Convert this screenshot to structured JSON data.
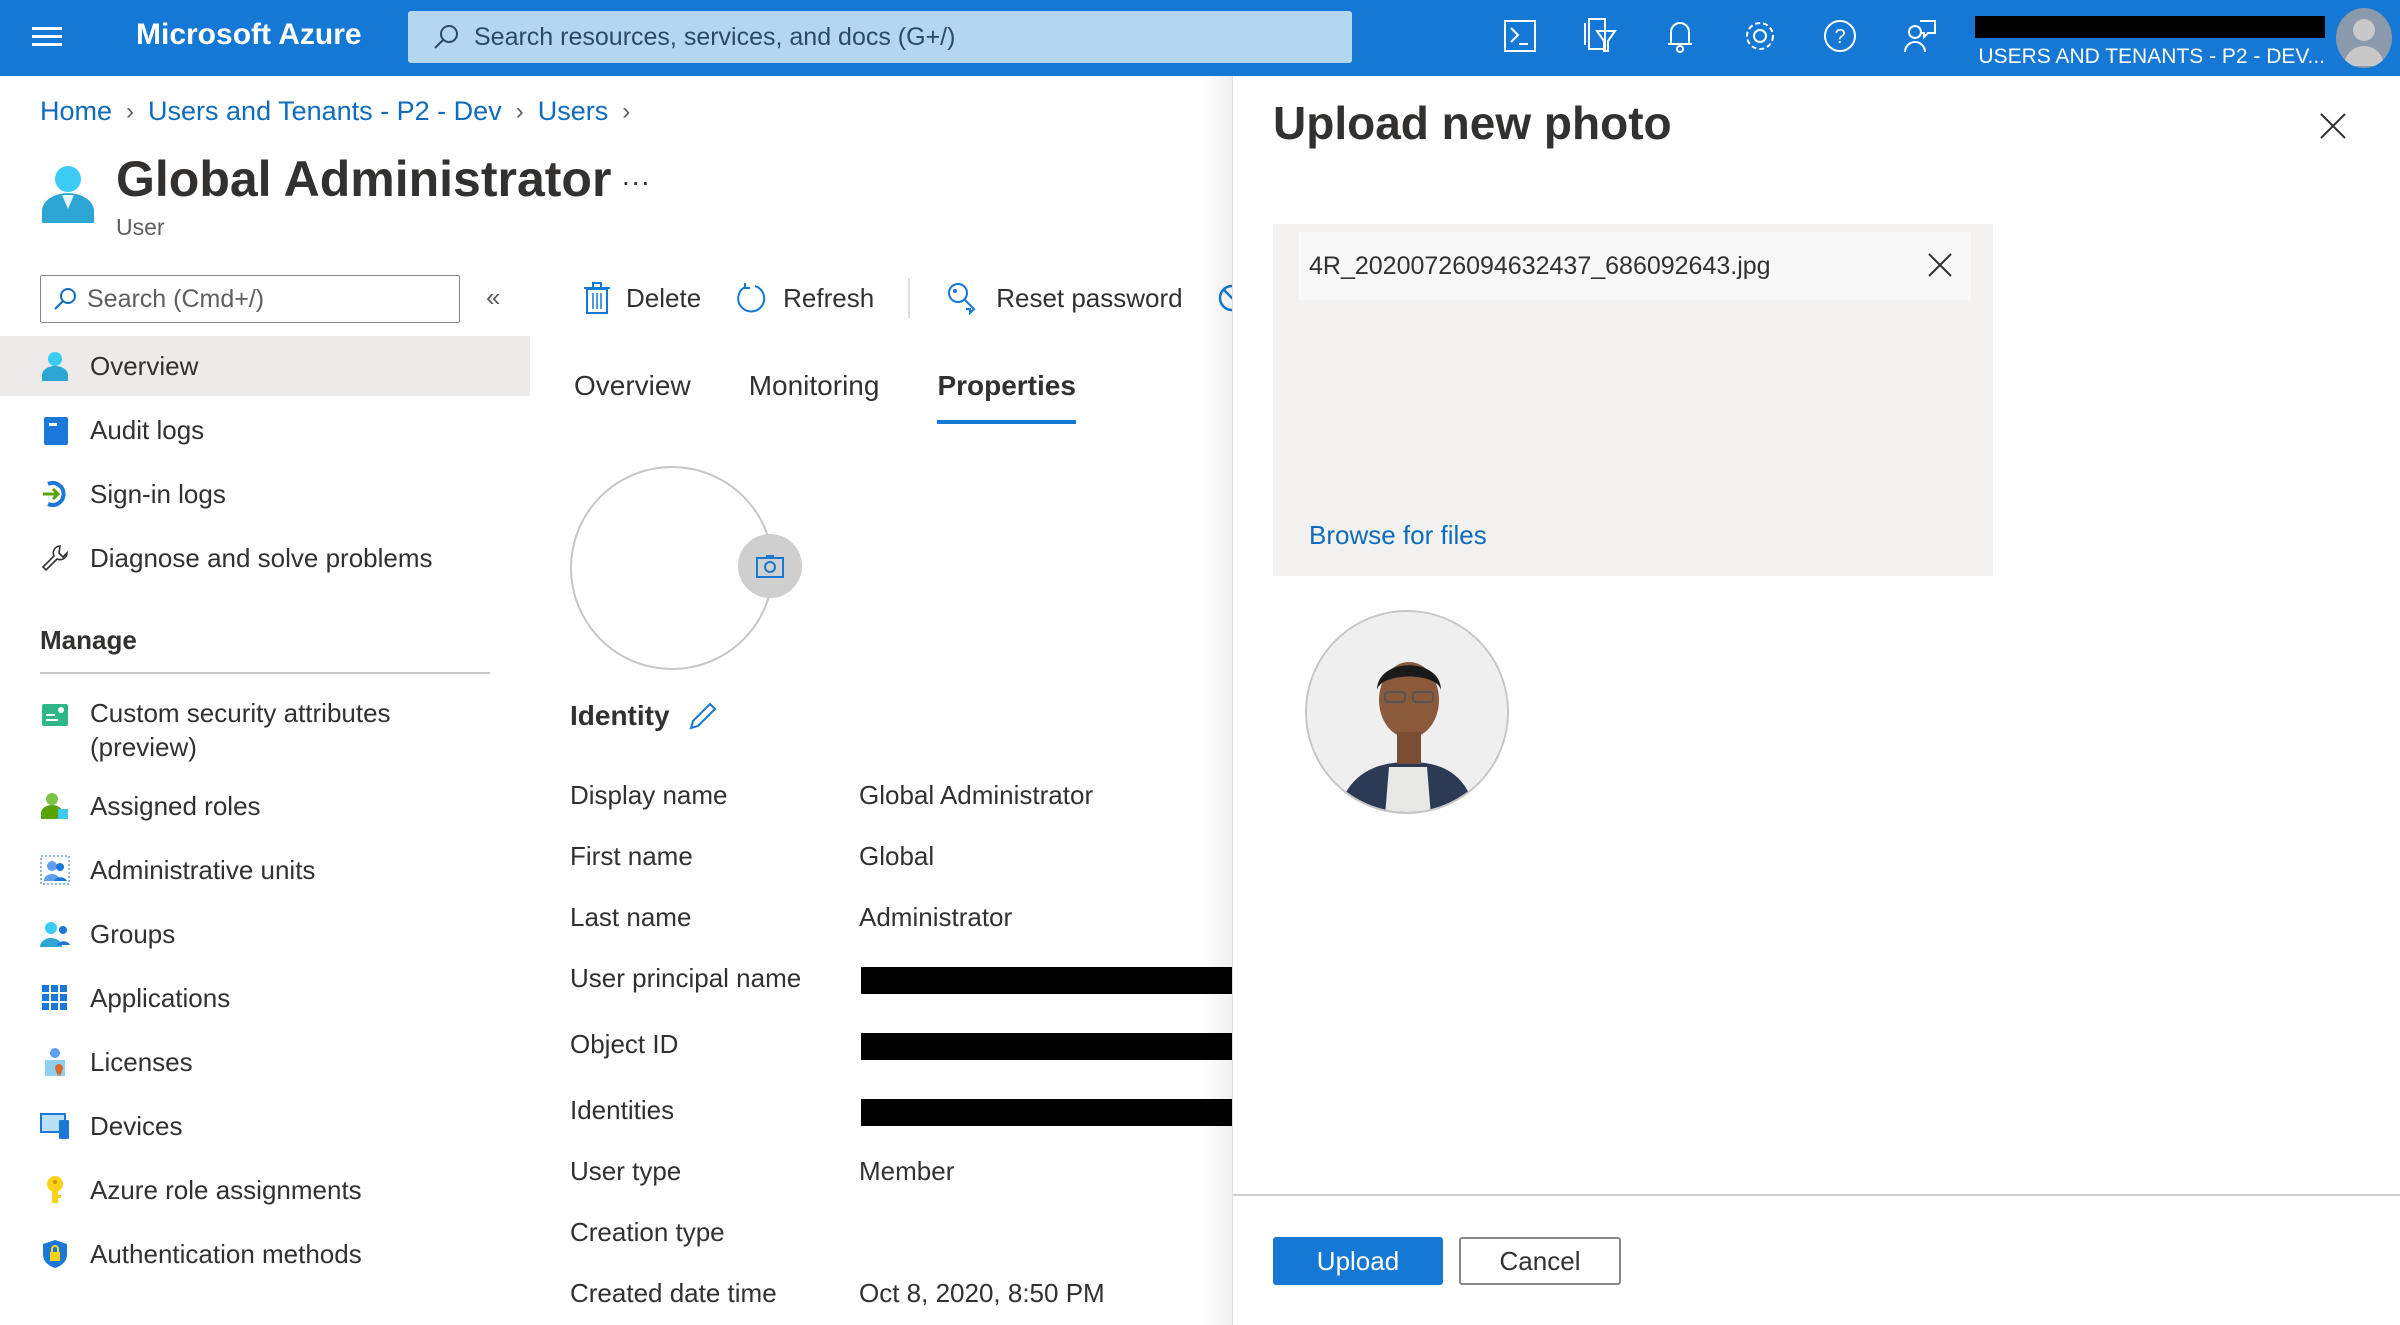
{
  "topbar": {
    "brand": "Microsoft Azure",
    "search_placeholder": "Search resources, services, and docs (G+/)",
    "icons": [
      "cloud-shell-icon",
      "directory-filter-icon",
      "notifications-icon",
      "settings-icon",
      "help-icon",
      "feedback-icon"
    ],
    "tenant": "USERS AND TENANTS - P2 - DEV..."
  },
  "breadcrumb": [
    "Home",
    "Users and Tenants - P2 - Dev",
    "Users"
  ],
  "header": {
    "title": "Global Administrator",
    "subtitle": "User",
    "more": "..."
  },
  "leftnav": {
    "search_placeholder": "Search (Cmd+/)",
    "items": [
      {
        "label": "Overview",
        "active": true
      },
      {
        "label": "Audit logs"
      },
      {
        "label": "Sign-in logs"
      },
      {
        "label": "Diagnose and solve problems"
      }
    ],
    "section": "Manage",
    "manage_items": [
      {
        "label": "Custom security attributes",
        "label2": "(preview)"
      },
      {
        "label": "Assigned roles"
      },
      {
        "label": "Administrative units"
      },
      {
        "label": "Groups"
      },
      {
        "label": "Applications"
      },
      {
        "label": "Licenses"
      },
      {
        "label": "Devices"
      },
      {
        "label": "Azure role assignments"
      },
      {
        "label": "Authentication methods"
      }
    ]
  },
  "commands": {
    "delete": "Delete",
    "refresh": "Refresh",
    "reset_password": "Reset password"
  },
  "tabs": [
    {
      "label": "Overview"
    },
    {
      "label": "Monitoring"
    },
    {
      "label": "Properties",
      "active": true
    }
  ],
  "identity": {
    "heading": "Identity",
    "rows": [
      {
        "key": "Display name",
        "value": "Global Administrator"
      },
      {
        "key": "First name",
        "value": "Global"
      },
      {
        "key": "Last name",
        "value": "Administrator"
      },
      {
        "key": "User principal name",
        "value": "[redacted]"
      },
      {
        "key": "Object ID",
        "value": "[redacted]"
      },
      {
        "key": "Identities",
        "value": "[redacted]"
      },
      {
        "key": "User type",
        "value": "Member"
      },
      {
        "key": "Creation type",
        "value": ""
      },
      {
        "key": "Created date time",
        "value": "Oct 8, 2020, 8:50 PM"
      }
    ]
  },
  "panel": {
    "title": "Upload new photo",
    "file_name": "4R_20200726094632437_686092643.jpg",
    "browse": "Browse for files",
    "upload": "Upload",
    "cancel": "Cancel"
  },
  "colors": {
    "brand": "#1478d4",
    "link": "#0f6cbd"
  }
}
